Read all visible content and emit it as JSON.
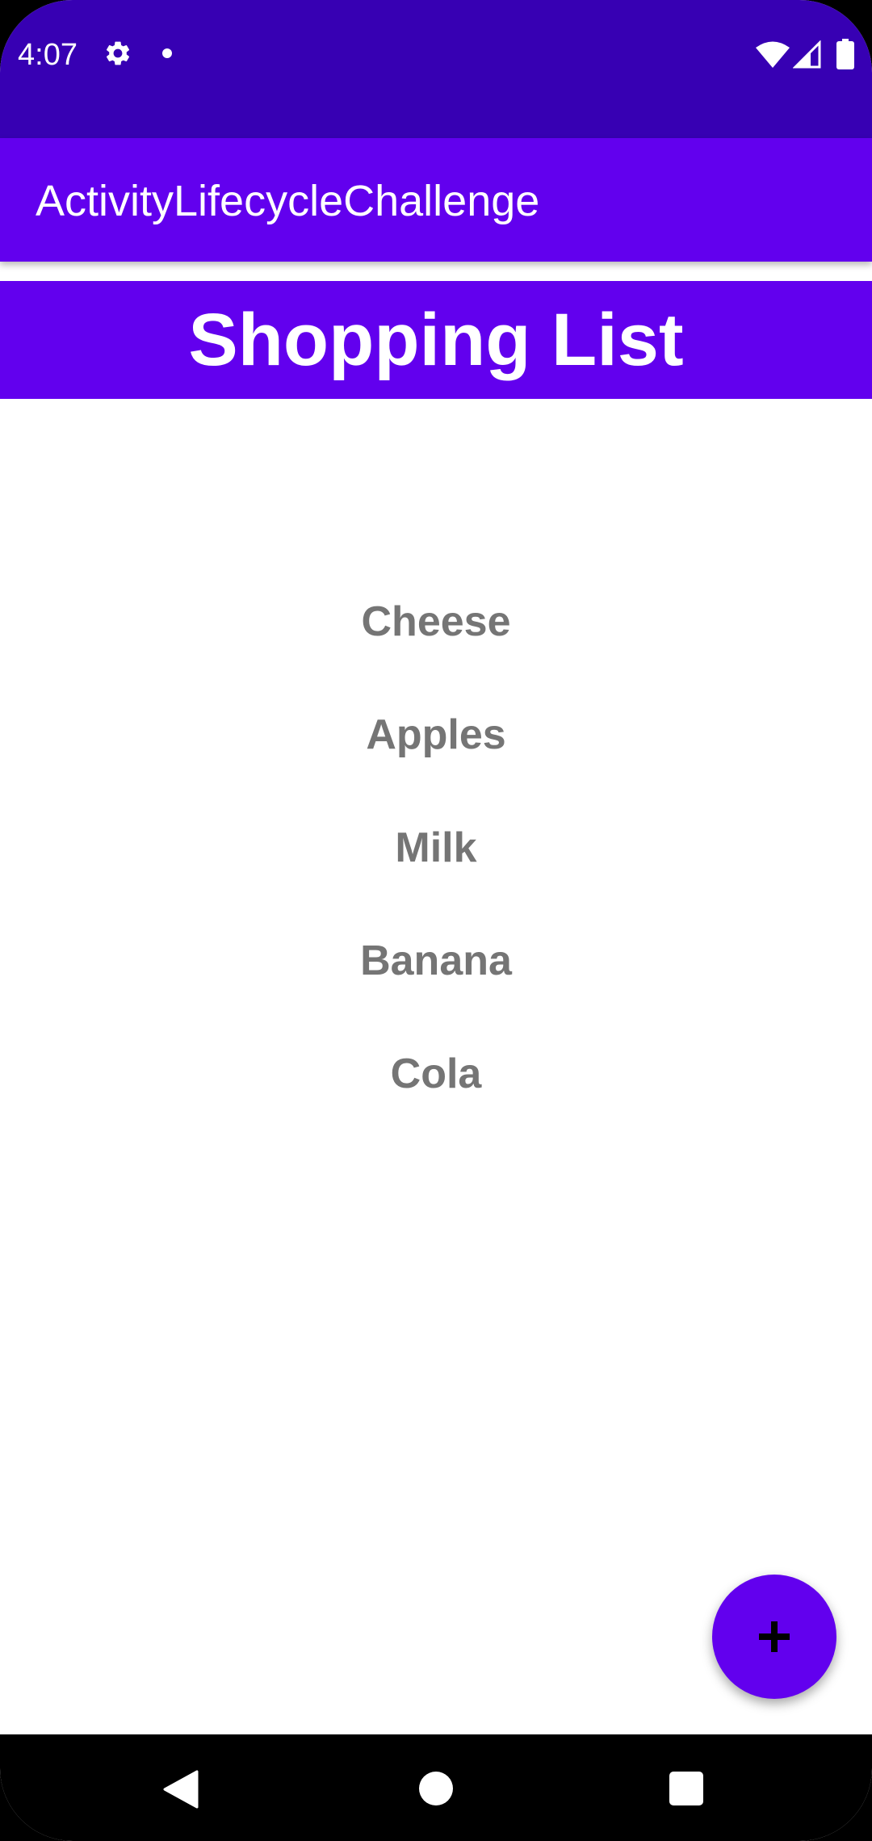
{
  "status_bar": {
    "time": "4:07",
    "icons": [
      "gear-icon",
      "notification-dot-icon",
      "wifi-icon",
      "signal-icon",
      "battery-icon"
    ]
  },
  "app_bar": {
    "title": "ActivityLifecycleChallenge"
  },
  "list_header": {
    "title": "Shopping List"
  },
  "shopping_items": [
    "Cheese",
    "Apples",
    "Milk",
    "Banana",
    "Cola"
  ],
  "fab": {
    "icon": "plus-icon"
  },
  "nav_bar": {
    "icons": [
      "back-icon",
      "home-icon",
      "recents-icon"
    ]
  },
  "colors": {
    "status_bar": "#3700b3",
    "primary": "#6200ee",
    "item_text": "#757575",
    "background": "#ffffff"
  }
}
